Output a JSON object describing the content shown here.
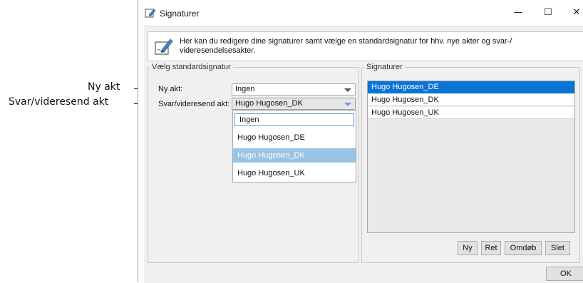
{
  "callouts": {
    "new_act": "Ny akt",
    "reply_forward_act": "Svar/videresend akt"
  },
  "window": {
    "title": "Signaturer",
    "controls": {
      "minimize": "—",
      "maximize": "☐",
      "close": "✕"
    }
  },
  "info": {
    "text": "Her kan du redigere dine signaturer samt vælge en standardsignatur for hhv. nye akter og svar-/ videresendelsesakter."
  },
  "default_group": {
    "legend": "Vælg standardsignatur",
    "new_act_label": "Ny akt:",
    "new_act_value": "Ingen",
    "reply_label": "Svar/videresend akt:",
    "reply_value": "Hugo Hugosen_DK",
    "dropdown_options": [
      "Ingen",
      "Hugo Hugosen_DE",
      "Hugo Hugosen_DK",
      "Hugo Hugosen_UK"
    ]
  },
  "signatures_group": {
    "legend": "Signaturer",
    "items": [
      "Hugo Hugosen_DE",
      "Hugo Hugosen_DK",
      "Hugo Hugosen_UK"
    ],
    "selected_item": "Hugo Hugosen_DE",
    "buttons": {
      "new": "Ny",
      "edit": "Ret",
      "rename": "Omdøb",
      "delete": "Slet"
    }
  },
  "ok_label": "OK"
}
